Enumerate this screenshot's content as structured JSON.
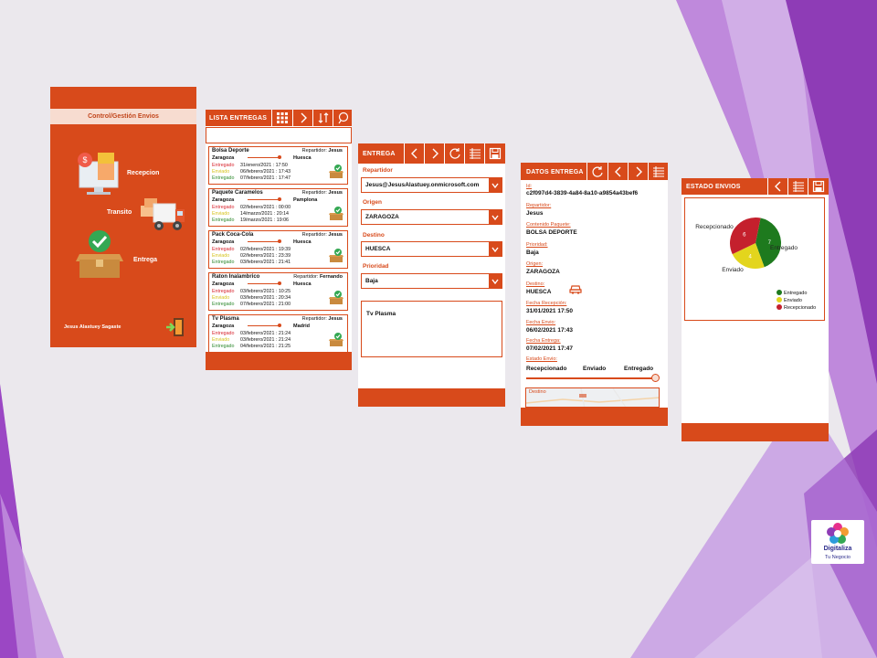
{
  "colors": {
    "brand": "#d84a1b",
    "brand_light": "#f7dcd0",
    "purple": "#8e3cb6",
    "green": "#1e7a1e",
    "yellow": "#e3d51d",
    "red": "#c4202d"
  },
  "panel_home": {
    "title": "Control/Gestión Envios",
    "menu": [
      {
        "label": "Recepcion",
        "icon": "desktop-shop-icon"
      },
      {
        "label": "Transito",
        "icon": "truck-icon"
      },
      {
        "label": "Entrega",
        "icon": "delivered-box-icon"
      }
    ],
    "user": "Jesus Alastuey Sagaste",
    "logout_icon": "exit-door-icon"
  },
  "panel_list": {
    "title": "LISTA ENTREGAS",
    "buttons": [
      "grid-icon",
      "chevron-right-icon",
      "sort-icon",
      "map-pin-icon"
    ],
    "search_value": "",
    "items": [
      {
        "name": "Bolsa Deporte",
        "rep_label": "Repartidor:",
        "rep": "Jesus",
        "origin": "Zaragoza",
        "dest": "Huesca",
        "statuses": [
          {
            "label": "Entregado",
            "date": "31/enero/2021 : 17:50",
            "color": "red"
          },
          {
            "label": "Enviado",
            "date": "06/febrero/2021 : 17:43",
            "color": "yellow"
          },
          {
            "label": "Entregado",
            "date": "07/febrero/2021 : 17:47",
            "color": "green"
          }
        ]
      },
      {
        "name": "Paquete Caramelos",
        "rep_label": "Repartidor:",
        "rep": "Jesus",
        "origin": "Zaragoza",
        "dest": "Pamplona",
        "statuses": [
          {
            "label": "Entregado",
            "date": "02/febrero/2021 : 00:00",
            "color": "red"
          },
          {
            "label": "Enviado",
            "date": "14/marzo/2021 : 20:14",
            "color": "yellow"
          },
          {
            "label": "Entregado",
            "date": "19/marzo/2021 : 19:06",
            "color": "green"
          }
        ]
      },
      {
        "name": "Pack Coca-Cola",
        "rep_label": "Repartidor:",
        "rep": "Jesus",
        "origin": "Zaragoza",
        "dest": "Huesca",
        "statuses": [
          {
            "label": "Entregado",
            "date": "02/febrero/2021 : 19:39",
            "color": "red"
          },
          {
            "label": "Enviado",
            "date": "02/febrero/2021 : 23:39",
            "color": "yellow"
          },
          {
            "label": "Entregado",
            "date": "03/febrero/2021 : 21:41",
            "color": "green"
          }
        ]
      },
      {
        "name": "Raton Inalambrico",
        "rep_label": "Repartidor:",
        "rep": "Fernando",
        "origin": "Zaragoza",
        "dest": "Huesca",
        "statuses": [
          {
            "label": "Entregado",
            "date": "03/febrero/2021 : 10:25",
            "color": "red"
          },
          {
            "label": "Enviado",
            "date": "03/febrero/2021 : 20:34",
            "color": "yellow"
          },
          {
            "label": "Entregado",
            "date": "07/febrero/2021 : 21:00",
            "color": "green"
          }
        ]
      },
      {
        "name": "Tv Plasma",
        "rep_label": "Repartidor:",
        "rep": "Jesus",
        "origin": "Zaragoza",
        "dest": "Madrid",
        "statuses": [
          {
            "label": "Entregado",
            "date": "03/febrero/2021 : 21:24",
            "color": "red"
          },
          {
            "label": "Enviado",
            "date": "03/febrero/2021 : 21:24",
            "color": "yellow"
          },
          {
            "label": "Entregado",
            "date": "04/febrero/2021 : 21:25",
            "color": "green"
          }
        ]
      }
    ]
  },
  "panel_form": {
    "title": "ENTREGA",
    "buttons": [
      "chevron-left-icon",
      "chevron-right-icon",
      "refresh-icon",
      "list-icon",
      "save-icon"
    ],
    "fields": [
      {
        "label": "Repartidor",
        "value": "Jesus@JesusAlastuey.onmicrosoft.com"
      },
      {
        "label": "Origen",
        "value": "ZARAGOZA"
      },
      {
        "label": "Destino",
        "value": "HUESCA"
      },
      {
        "label": "Prioridad",
        "value": "Baja"
      }
    ],
    "description": "Tv Plasma"
  },
  "panel_detail": {
    "title": "DATOS ENTREGA",
    "buttons": [
      "refresh-icon",
      "chevron-left-icon",
      "chevron-right-icon",
      "list-icon"
    ],
    "fields": [
      {
        "label": "Id:",
        "value": "c2f097d4-3839-4a84-8a10-a9854a43bef6"
      },
      {
        "label": "Repartidor:",
        "value": "Jesus"
      },
      {
        "label": "Contenido Paquete:",
        "value": "BOLSA DEPORTE"
      },
      {
        "label": "Prioridad:",
        "value": "Baja"
      },
      {
        "label": "Origen:",
        "value": "ZARAGOZA"
      },
      {
        "label": "Destino:",
        "value": "HUESCA"
      },
      {
        "label": "Fecha Recepción:",
        "value": "31/01/2021 17:50"
      },
      {
        "label": "Fecha Envio:",
        "value": "06/02/2021 17:43"
      },
      {
        "label": "Fecha Entrega:",
        "value": "07/02/2021 17:47"
      },
      {
        "label": "Estado Envio:",
        "value": ""
      }
    ],
    "status_steps": [
      "Recepcionado",
      "Enviado",
      "Entregado"
    ],
    "status_progress": 1.0,
    "map_label": "Destino"
  },
  "panel_chart": {
    "title": "ESTADO ENVIOS",
    "buttons": [
      "chevron-left-icon",
      "list-icon",
      "save-icon"
    ]
  },
  "chart_data": {
    "type": "pie",
    "categories": [
      "Entregado",
      "Enviado",
      "Recepcionado"
    ],
    "values": [
      7,
      4,
      6
    ],
    "colors": [
      "#1e7a1e",
      "#e3d51d",
      "#c4202d"
    ],
    "legend": "bottom-right"
  },
  "logo": {
    "line1": "Digitaliza",
    "line2": "Tu Negocio"
  }
}
